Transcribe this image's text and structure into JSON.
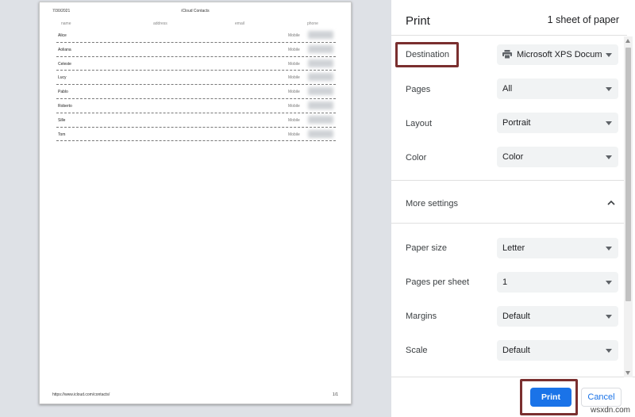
{
  "preview": {
    "date": "7/30/2021",
    "title": "iCloud Contacts",
    "columns": [
      "name",
      "address",
      "email",
      "phone"
    ],
    "rows": [
      {
        "name": "Alice",
        "phone_label": "Mobile"
      },
      {
        "name": "Aoliana",
        "phone_label": "Mobile"
      },
      {
        "name": "Celeste",
        "phone_label": "Mobile"
      },
      {
        "name": "Lucy",
        "phone_label": "Mobile"
      },
      {
        "name": "Pablo",
        "phone_label": "Mobile"
      },
      {
        "name": "Roberto",
        "phone_label": "Mobile"
      },
      {
        "name": "Sille",
        "phone_label": "Mobile"
      },
      {
        "name": "Tom",
        "phone_label": "Mobile"
      }
    ],
    "footer_url": "https://www.icloud.com/contacts/",
    "footer_page": "1/1"
  },
  "panel": {
    "title": "Print",
    "sheet_count": "1 sheet of paper",
    "destination": {
      "label": "Destination",
      "value": "Microsoft XPS Docum"
    },
    "pages": {
      "label": "Pages",
      "value": "All"
    },
    "layout": {
      "label": "Layout",
      "value": "Portrait"
    },
    "color": {
      "label": "Color",
      "value": "Color"
    },
    "more_settings": "More settings",
    "paper_size": {
      "label": "Paper size",
      "value": "Letter"
    },
    "pages_per_sheet": {
      "label": "Pages per sheet",
      "value": "1"
    },
    "margins": {
      "label": "Margins",
      "value": "Default"
    },
    "scale": {
      "label": "Scale",
      "value": "Default"
    },
    "print_button": "Print",
    "cancel_button": "Cancel"
  },
  "icons": {
    "printer": "printer-icon",
    "chevron": "chevron-up-icon",
    "caret": "caret-down-icon"
  },
  "colors": {
    "accent": "#1a73e8",
    "highlight": "#7a2f2f"
  },
  "watermark": "wsxdn.com"
}
